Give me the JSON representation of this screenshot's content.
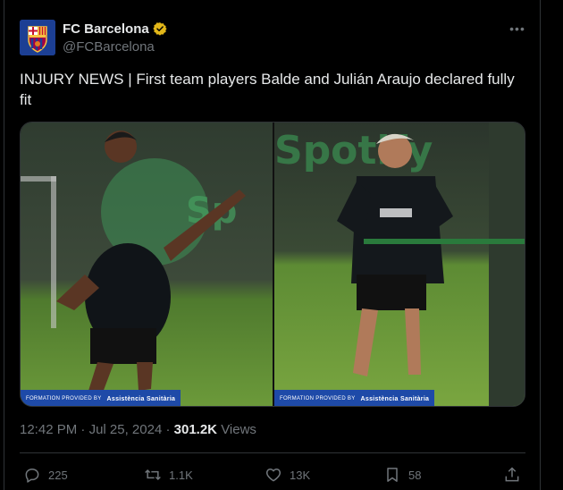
{
  "account": {
    "display_name": "FC Barcelona",
    "handle": "@FCBarcelona"
  },
  "tweet": {
    "text_line1": "INJURY NEWS | First team players Balde and Julián Araujo declared fully",
    "text_line2": "fit"
  },
  "media": {
    "watermark_prefix": "FORMATION PROVIDED BY",
    "watermark_brand": "Assistència Sanitària",
    "left_photo_label": "Balde training",
    "right_photo_label": "Julián Araujo training"
  },
  "meta": {
    "time": "12:42 PM",
    "separator": "·",
    "date": "Jul 25, 2024",
    "views_count": "301.2K",
    "views_label": "Views"
  },
  "actions": {
    "replies": "225",
    "reposts": "1.1K",
    "likes": "13K",
    "bookmarks": "58"
  },
  "colors": {
    "background": "#000000",
    "text": "#e7e9ea",
    "muted": "#71767b",
    "border": "#2f3336",
    "verified": "#e2b719"
  }
}
